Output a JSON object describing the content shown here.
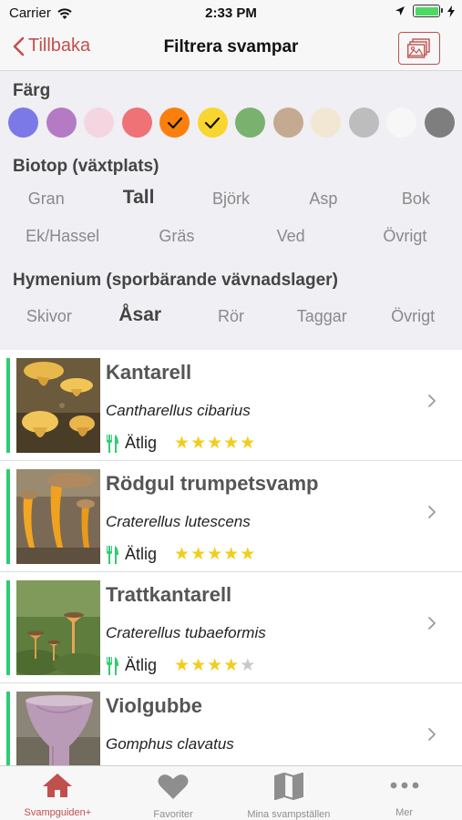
{
  "status_bar": {
    "carrier": "Carrier",
    "time": "2:33 PM"
  },
  "nav": {
    "back_label": "Tillbaka",
    "title": "Filtrera svampar"
  },
  "filters": {
    "color_title": "Färg",
    "colors": [
      {
        "hex": "#7b78e8",
        "selected": false
      },
      {
        "hex": "#b47bc4",
        "selected": false
      },
      {
        "hex": "#f5d6e0",
        "selected": false
      },
      {
        "hex": "#ee7276",
        "selected": false
      },
      {
        "hex": "#fb7f0d",
        "selected": true
      },
      {
        "hex": "#f9d62f",
        "selected": true
      },
      {
        "hex": "#7bb16f",
        "selected": false
      },
      {
        "hex": "#c4aa90",
        "selected": false
      },
      {
        "hex": "#f1e7d2",
        "selected": false
      },
      {
        "hex": "#bdbdbd",
        "selected": false
      },
      {
        "hex": "#f7f7f7",
        "selected": false
      },
      {
        "hex": "#7e7e7e",
        "selected": false
      }
    ],
    "biotop_title": "Biotop (växtplats)",
    "biotop_row1": [
      {
        "label": "Gran",
        "active": false
      },
      {
        "label": "Tall",
        "active": true
      },
      {
        "label": "Björk",
        "active": false
      },
      {
        "label": "Asp",
        "active": false
      },
      {
        "label": "Bok",
        "active": false
      }
    ],
    "biotop_row2": [
      {
        "label": "Ek/Hassel",
        "active": false
      },
      {
        "label": "Gräs",
        "active": false
      },
      {
        "label": "Ved",
        "active": false
      },
      {
        "label": "Övrigt",
        "active": false
      }
    ],
    "hymenium_title": "Hymenium (sporbärande vävnadslager)",
    "hymenium": [
      {
        "label": "Skivor",
        "active": false
      },
      {
        "label": "Åsar",
        "active": true
      },
      {
        "label": "Rör",
        "active": false
      },
      {
        "label": "Taggar",
        "active": false
      },
      {
        "label": "Övrigt",
        "active": false
      }
    ]
  },
  "mushrooms": [
    {
      "name": "Kantarell",
      "latin": "Cantharellus cibarius",
      "edibility": "Ätlig",
      "rating": 5,
      "accent": "#2ecc71"
    },
    {
      "name": "Rödgul trumpetsvamp",
      "latin": "Craterellus lutescens",
      "edibility": "Ätlig",
      "rating": 5,
      "accent": "#2ecc71"
    },
    {
      "name": "Trattkantarell",
      "latin": "Craterellus tubaeformis",
      "edibility": "Ätlig",
      "rating": 4,
      "accent": "#2ecc71"
    },
    {
      "name": "Violgubbe",
      "latin": "Gomphus clavatus",
      "edibility": "",
      "rating": 0,
      "accent": "#2ecc71"
    }
  ],
  "tabbar": {
    "tabs": [
      {
        "label": "Svampguiden+",
        "icon": "home-icon",
        "active": true
      },
      {
        "label": "Favoriter",
        "icon": "heart-icon",
        "active": false
      },
      {
        "label": "Mina svampställen",
        "icon": "map-icon",
        "active": false
      },
      {
        "label": "Mer",
        "icon": "more-icon",
        "active": false
      }
    ]
  },
  "theme": {
    "accent": "#c0504d",
    "star": "#f2cd1d",
    "edible": "#2ecc71"
  }
}
